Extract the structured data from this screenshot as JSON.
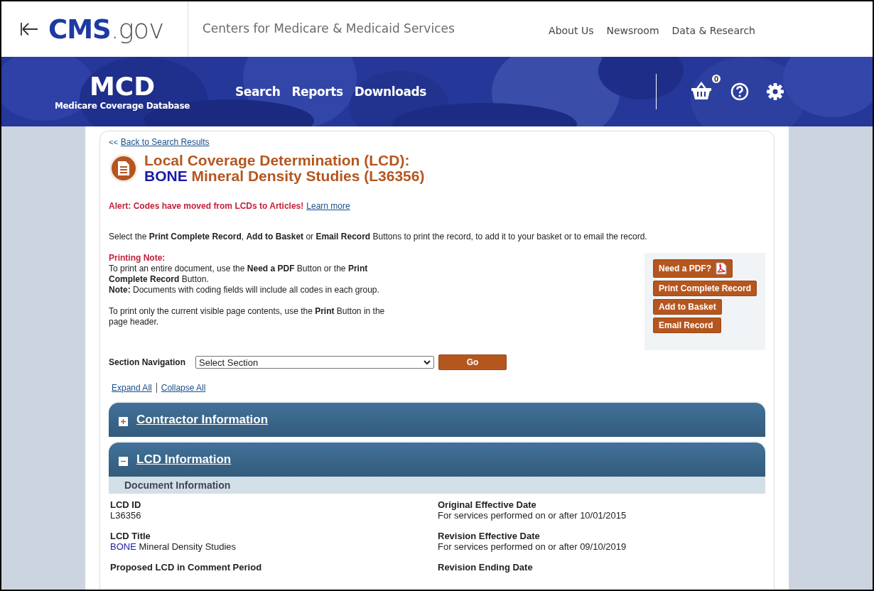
{
  "cms_header": {
    "logo_main": "CMS",
    "logo_suffix": ".gov",
    "tagline": "Centers for Medicare & Medicaid Services",
    "nav_links": [
      "About Us",
      "Newsroom",
      "Data & Research"
    ]
  },
  "banner": {
    "title": "MCD",
    "subtitle": "Medicare Coverage Database",
    "nav": [
      "Search",
      "Reports",
      "Downloads"
    ],
    "basket_count": "0"
  },
  "back_link": {
    "prefix": "<<",
    "text": "Back to Search Results"
  },
  "heading": {
    "line1": "Local Coverage Determination (LCD):",
    "highlight": "BONE",
    "line2": "Mineral Density Studies (L36356)"
  },
  "alert": {
    "text": "Alert: Codes have moved from LCDs to Articles!",
    "link": "Learn more"
  },
  "instructions": "Select the **Print Complete Record**, **Add to Basket** or **Email Record** Buttons to print the record, to add it to your basket or to email the record.",
  "printing_note": {
    "title": "Printing Note:",
    "paragraphs": [
      "To print an entire document, use the **Need a PDF** Button or the **Print Complete Record** Button.",
      "**Note:** Documents with coding fields will include all codes in each group.",
      "To print only the current visible page contents, use the **Print** Button in the page header."
    ]
  },
  "action_buttons": [
    {
      "label": "Need a PDF?",
      "kind": "pdf"
    },
    {
      "label": "Print Complete Record",
      "kind": "plain"
    },
    {
      "label": "Add to Basket",
      "kind": "plain"
    },
    {
      "label": "Email Record",
      "kind": "plain"
    }
  ],
  "section_nav": {
    "label": "Section Navigation",
    "value": "Select Section",
    "button": "Go"
  },
  "toggle_links": [
    "Expand All",
    "Collapse All"
  ],
  "sections": [
    {
      "title": "Contractor Information",
      "expanded": false
    },
    {
      "title": "LCD Information",
      "expanded": true,
      "subheader": "Document Information",
      "fields": [
        {
          "label": "LCD ID",
          "value": "L36356"
        },
        {
          "label": "Original Effective Date",
          "value": "For services performed on or after 10/01/2015"
        },
        {
          "label": "LCD Title",
          "highlight": "BONE",
          "value": "Mineral Density Studies"
        },
        {
          "label": "Revision Effective Date",
          "value": "For services performed on or after 09/10/2019"
        },
        {
          "label": "Proposed LCD in Comment Period"
        },
        {
          "label": "Revision Ending Date"
        }
      ]
    }
  ]
}
